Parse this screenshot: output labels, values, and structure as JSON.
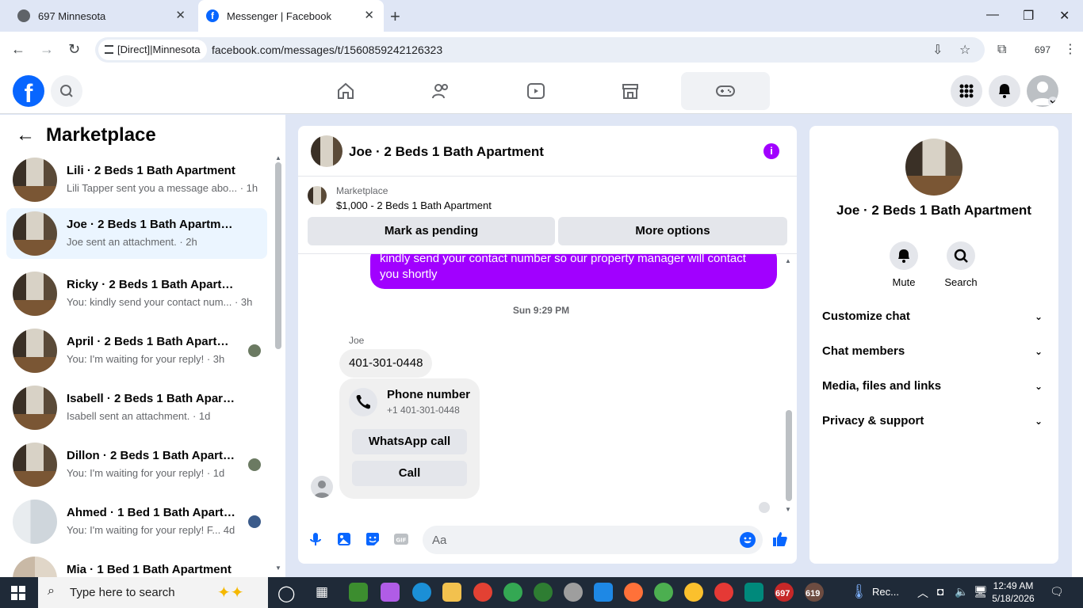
{
  "browser": {
    "tabs": [
      {
        "title": "697 Minnesota"
      },
      {
        "title": "Messenger | Facebook"
      }
    ],
    "omnibox": {
      "chip": "[Direct]|Minnesota",
      "url": "facebook.com/messages/t/1560859242126323"
    },
    "profile_count": "697"
  },
  "sidebar": {
    "title": "Marketplace",
    "conversations": [
      {
        "name": "Lili · 2 Beds 1 Bath Apartment",
        "preview": "Lili Tapper sent you a message abo... · 1h"
      },
      {
        "name": "Joe · 2 Beds 1 Bath Apartment",
        "preview": "Joe sent an attachment. · 2h"
      },
      {
        "name": "Ricky · 2 Beds 1 Bath Apartment",
        "preview": "You: kindly send your contact num... · 3h"
      },
      {
        "name": "April · 2 Beds 1 Bath Apartment",
        "preview": "You: I'm waiting for your reply! · 3h"
      },
      {
        "name": "Isabell · 2 Beds 1 Bath Apartment",
        "preview": "Isabell sent an attachment. · 1d"
      },
      {
        "name": "Dillon · 2 Beds 1 Bath Apartm...",
        "preview": "You: I'm waiting for your reply! · 1d"
      },
      {
        "name": "Ahmed · 1 Bed 1 Bath Apartm...",
        "preview": "You: I'm waiting for your reply! F... 4d"
      },
      {
        "name": "Mia · 1 Bed 1 Bath Apartment",
        "preview": ""
      }
    ]
  },
  "chat": {
    "title": "Joe · 2 Beds 1 Bath Apartment",
    "marketplace_label": "Marketplace",
    "listing": "$1,000 - 2 Beds 1 Bath Apartment",
    "mark_pending": "Mark as pending",
    "more_options": "More options",
    "outgoing": "kindly send your contact number so our property manager will contact you shortly",
    "timestamp": "Sun 9:29 PM",
    "sender": "Joe",
    "incoming": "401-301-0448",
    "card": {
      "title": "Phone number",
      "number": "+1 401-301-0448",
      "whatsapp": "WhatsApp call",
      "call": "Call"
    },
    "composer_placeholder": "Aa"
  },
  "details": {
    "name": "Joe · 2 Beds 1 Bath Apartment",
    "mute": "Mute",
    "search": "Search",
    "sections": [
      "Customize chat",
      "Chat members",
      "Media, files and links",
      "Privacy & support"
    ]
  },
  "taskbar": {
    "search_placeholder": "Type here to search",
    "badge1": "697",
    "badge2": "619",
    "rec": "Rec...",
    "time": "12:49 AM",
    "date": "5/18/2026"
  },
  "colors": {
    "facebook_blue": "#0866ff",
    "messenger_purple": "#a100ff",
    "selected_row": "#ebf5ff"
  }
}
